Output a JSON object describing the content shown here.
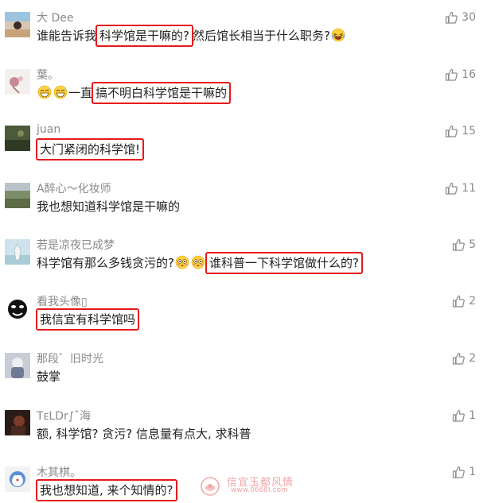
{
  "comments": [
    {
      "nickname": "大 Dee",
      "likes": "30",
      "parts": [
        {
          "t": "谁能告诉我"
        },
        {
          "t": "科学馆是干嘛的?",
          "hl": true
        },
        {
          "t": " 然后馆长相当于什么职务?"
        },
        {
          "emoji": "laugh-tears-emoji"
        }
      ]
    },
    {
      "nickname": "葉。",
      "likes": "16",
      "parts": [
        {
          "emoji": "grin-sweat-emoji"
        },
        {
          "emoji": "grin-sweat-emoji"
        },
        {
          "t": "一直"
        },
        {
          "t": "搞不明白科学馆是干嘛的",
          "hl": true
        }
      ]
    },
    {
      "nickname": "juan",
      "likes": "15",
      "parts": [
        {
          "t": "大门紧闭的科学馆!",
          "hl": true
        }
      ]
    },
    {
      "nickname": "A醉心～化妆师",
      "likes": "11",
      "parts": [
        {
          "t": "我也想知道科学馆是干嘛的"
        }
      ]
    },
    {
      "nickname": "若是凉夜已成梦",
      "likes": "5",
      "parts": [
        {
          "t": "科学馆有那么多钱贪污的?"
        },
        {
          "emoji": "flushed-emoji"
        },
        {
          "emoji": "flushed-emoji"
        },
        {
          "t": "谁科普一下科学馆做什么的?",
          "hl": true
        }
      ]
    },
    {
      "nickname": "看我头像▯",
      "likes": "2",
      "parts": [
        {
          "t": "我信宜有科学馆吗",
          "hl": true
        }
      ]
    },
    {
      "nickname": "那段゛旧时光",
      "likes": "2",
      "parts": [
        {
          "t": "鼓掌"
        }
      ]
    },
    {
      "nickname": "TᴇLDr∫ˆ海",
      "likes": "1",
      "parts": [
        {
          "t": "额, 科学馆? 贪污? 信息量有点大, 求科普"
        }
      ]
    },
    {
      "nickname": "木其棋。",
      "likes": "1",
      "parts": [
        {
          "t": "我也想知道, 来个知情的?",
          "hl": true
        }
      ]
    }
  ],
  "watermark": {
    "title": "信宜玉都风情",
    "url": "www.0668I.com"
  },
  "colors": {
    "highlight_border": "#e8191b",
    "nickname": "#8a8a8a",
    "text": "#222222",
    "watermark": "#f2a5a8"
  },
  "icons": {
    "like": "thumbs-up-icon"
  }
}
